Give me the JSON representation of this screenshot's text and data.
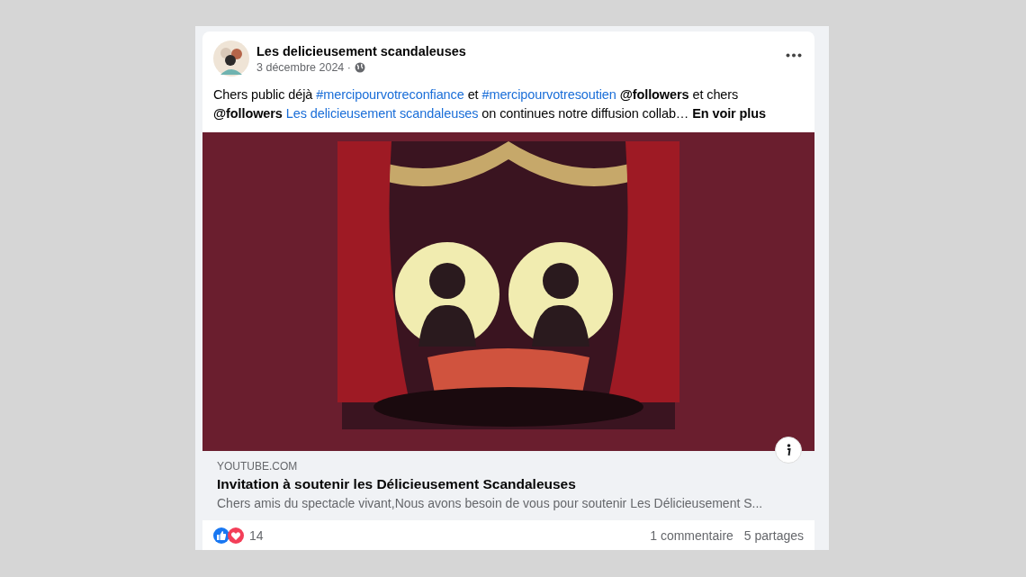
{
  "post": {
    "author": "Les delicieusement scandaleuses",
    "date": "3 décembre 2024 ·",
    "body": [
      {
        "kind": "text",
        "text": "Chers public déjà "
      },
      {
        "kind": "hashtag",
        "text": "#mercipourvotreconfiance"
      },
      {
        "kind": "text",
        "text": "  et "
      },
      {
        "kind": "hashtag",
        "text": "#mercipourvotresoutien",
        "space_after": true
      },
      {
        "kind": "mention",
        "text": "@followers"
      },
      {
        "kind": "text",
        "text": " et chers "
      },
      {
        "kind": "mention",
        "text": "@followers",
        "space_after": true
      },
      {
        "kind": "page",
        "text": "Les delicieusement scandaleuses"
      },
      {
        "kind": "text",
        "text": " on continues notre diffusion collab… "
      },
      {
        "kind": "more",
        "text": "En voir plus"
      }
    ],
    "link": {
      "kind": "picture",
      "domain": "YOUTUBE.COM",
      "title": "Invitation à soutenir les Délicieusement Scandaleuses",
      "description": "Chers amis du spectacle vivant,Nous avons besoin de vous pour soutenir Les Délicieusement S..."
    },
    "reactions": {
      "count": "14",
      "comments": "1 commentaire",
      "shares": "5 partages"
    }
  }
}
